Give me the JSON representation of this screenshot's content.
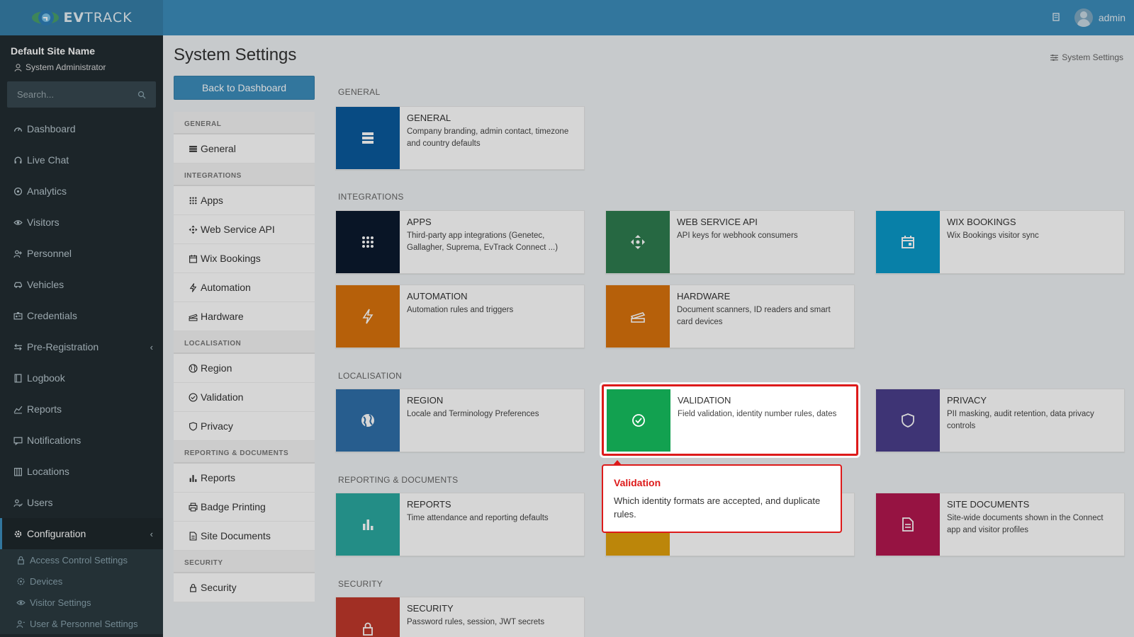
{
  "app": {
    "logo_text_bold": "EV",
    "logo_text_light": "TRACK",
    "user_name": "admin"
  },
  "sidebar": {
    "site_name": "Default Site Name",
    "role": "System Administrator",
    "search_placeholder": "Search...",
    "items": [
      {
        "label": "Dashboard",
        "icon": "dashboard-icon"
      },
      {
        "label": "Live Chat",
        "icon": "headset-icon"
      },
      {
        "label": "Analytics",
        "icon": "target-icon"
      },
      {
        "label": "Visitors",
        "icon": "eye-icon"
      },
      {
        "label": "Personnel",
        "icon": "user-group-icon"
      },
      {
        "label": "Vehicles",
        "icon": "car-icon"
      },
      {
        "label": "Credentials",
        "icon": "id-card-icon"
      },
      {
        "label": "Pre-Registration",
        "icon": "arrows-icon"
      },
      {
        "label": "Logbook",
        "icon": "book-icon"
      },
      {
        "label": "Reports",
        "icon": "chart-icon"
      },
      {
        "label": "Notifications",
        "icon": "bell-icon"
      },
      {
        "label": "Locations",
        "icon": "building-icon"
      },
      {
        "label": "Users",
        "icon": "users-icon"
      },
      {
        "label": "Configuration",
        "icon": "gear-icon"
      }
    ],
    "sub_items": [
      {
        "label": "Access Control Settings",
        "icon": "lock-icon"
      },
      {
        "label": "Devices",
        "icon": "device-icon"
      },
      {
        "label": "Visitor Settings",
        "icon": "eye-icon"
      },
      {
        "label": "User & Personnel Settings",
        "icon": "user-group-icon"
      }
    ]
  },
  "page": {
    "title": "System Settings",
    "breadcrumb": "System Settings",
    "back_button": "Back to Dashboard"
  },
  "left_menu": {
    "sections": [
      {
        "title": "GENERAL",
        "items": [
          "General"
        ]
      },
      {
        "title": "INTEGRATIONS",
        "items": [
          "Apps",
          "Web Service API",
          "Wix Bookings",
          "Automation",
          "Hardware"
        ]
      },
      {
        "title": "LOCALISATION",
        "items": [
          "Region",
          "Validation",
          "Privacy"
        ]
      },
      {
        "title": "REPORTING & DOCUMENTS",
        "items": [
          "Reports",
          "Badge Printing",
          "Site Documents"
        ]
      },
      {
        "title": "SECURITY",
        "items": [
          "Security"
        ]
      }
    ]
  },
  "sections": {
    "general": "GENERAL",
    "integrations": "INTEGRATIONS",
    "localisation": "LOCALISATION",
    "reporting": "REPORTING & DOCUMENTS",
    "security": "SECURITY"
  },
  "cards": {
    "general": {
      "title": "GENERAL",
      "desc": "Company branding, admin contact, timezone and country defaults",
      "color": "#0a5a9c",
      "icon": "server-icon"
    },
    "apps": {
      "title": "APPS",
      "desc": "Third-party app integrations (Genetec, Gallagher, Suprema, EvTrack Connect ...)",
      "color": "#0b1a2e",
      "icon": "grid-icon"
    },
    "web_service_api": {
      "title": "WEB SERVICE API",
      "desc": "API keys for webhook consumers",
      "color": "#2e7d4f",
      "icon": "move-icon"
    },
    "wix_bookings": {
      "title": "WIX BOOKINGS",
      "desc": "Wix Bookings visitor sync",
      "color": "#0a99c9",
      "icon": "calendar-icon"
    },
    "automation": {
      "title": "AUTOMATION",
      "desc": "Automation rules and triggers",
      "color": "#d9730d",
      "icon": "bolt-icon"
    },
    "hardware": {
      "title": "HARDWARE",
      "desc": "Document scanners, ID readers and smart card devices",
      "color": "#d9730d",
      "icon": "scanner-icon"
    },
    "region": {
      "title": "REGION",
      "desc": "Locale and Terminology Preferences",
      "color": "#2f6faa",
      "icon": "globe-icon"
    },
    "validation": {
      "title": "VALIDATION",
      "desc": "Field validation, identity number rules, dates",
      "color": "#12a150",
      "icon": "check-circle-icon"
    },
    "privacy": {
      "title": "PRIVACY",
      "desc": "PII masking, audit retention, data privacy controls",
      "color": "#4a3f8c",
      "icon": "shield-icon"
    },
    "reports": {
      "title": "REPORTS",
      "desc": "Time attendance and reporting defaults",
      "color": "#2aa8a0",
      "icon": "bar-chart-icon"
    },
    "badge_printing": {
      "color": "#e0a00c"
    },
    "site_documents": {
      "title": "SITE DOCUMENTS",
      "desc": "Site-wide documents shown in the Connect app and visitor profiles",
      "color": "#b3174f",
      "icon": "document-icon"
    },
    "security": {
      "title": "SECURITY",
      "desc": "Password rules, session, JWT secrets",
      "color": "#c0392b",
      "icon": "lock-icon"
    }
  },
  "tooltip": {
    "title": "Validation",
    "text": "Which identity formats are accepted, and duplicate rules."
  }
}
